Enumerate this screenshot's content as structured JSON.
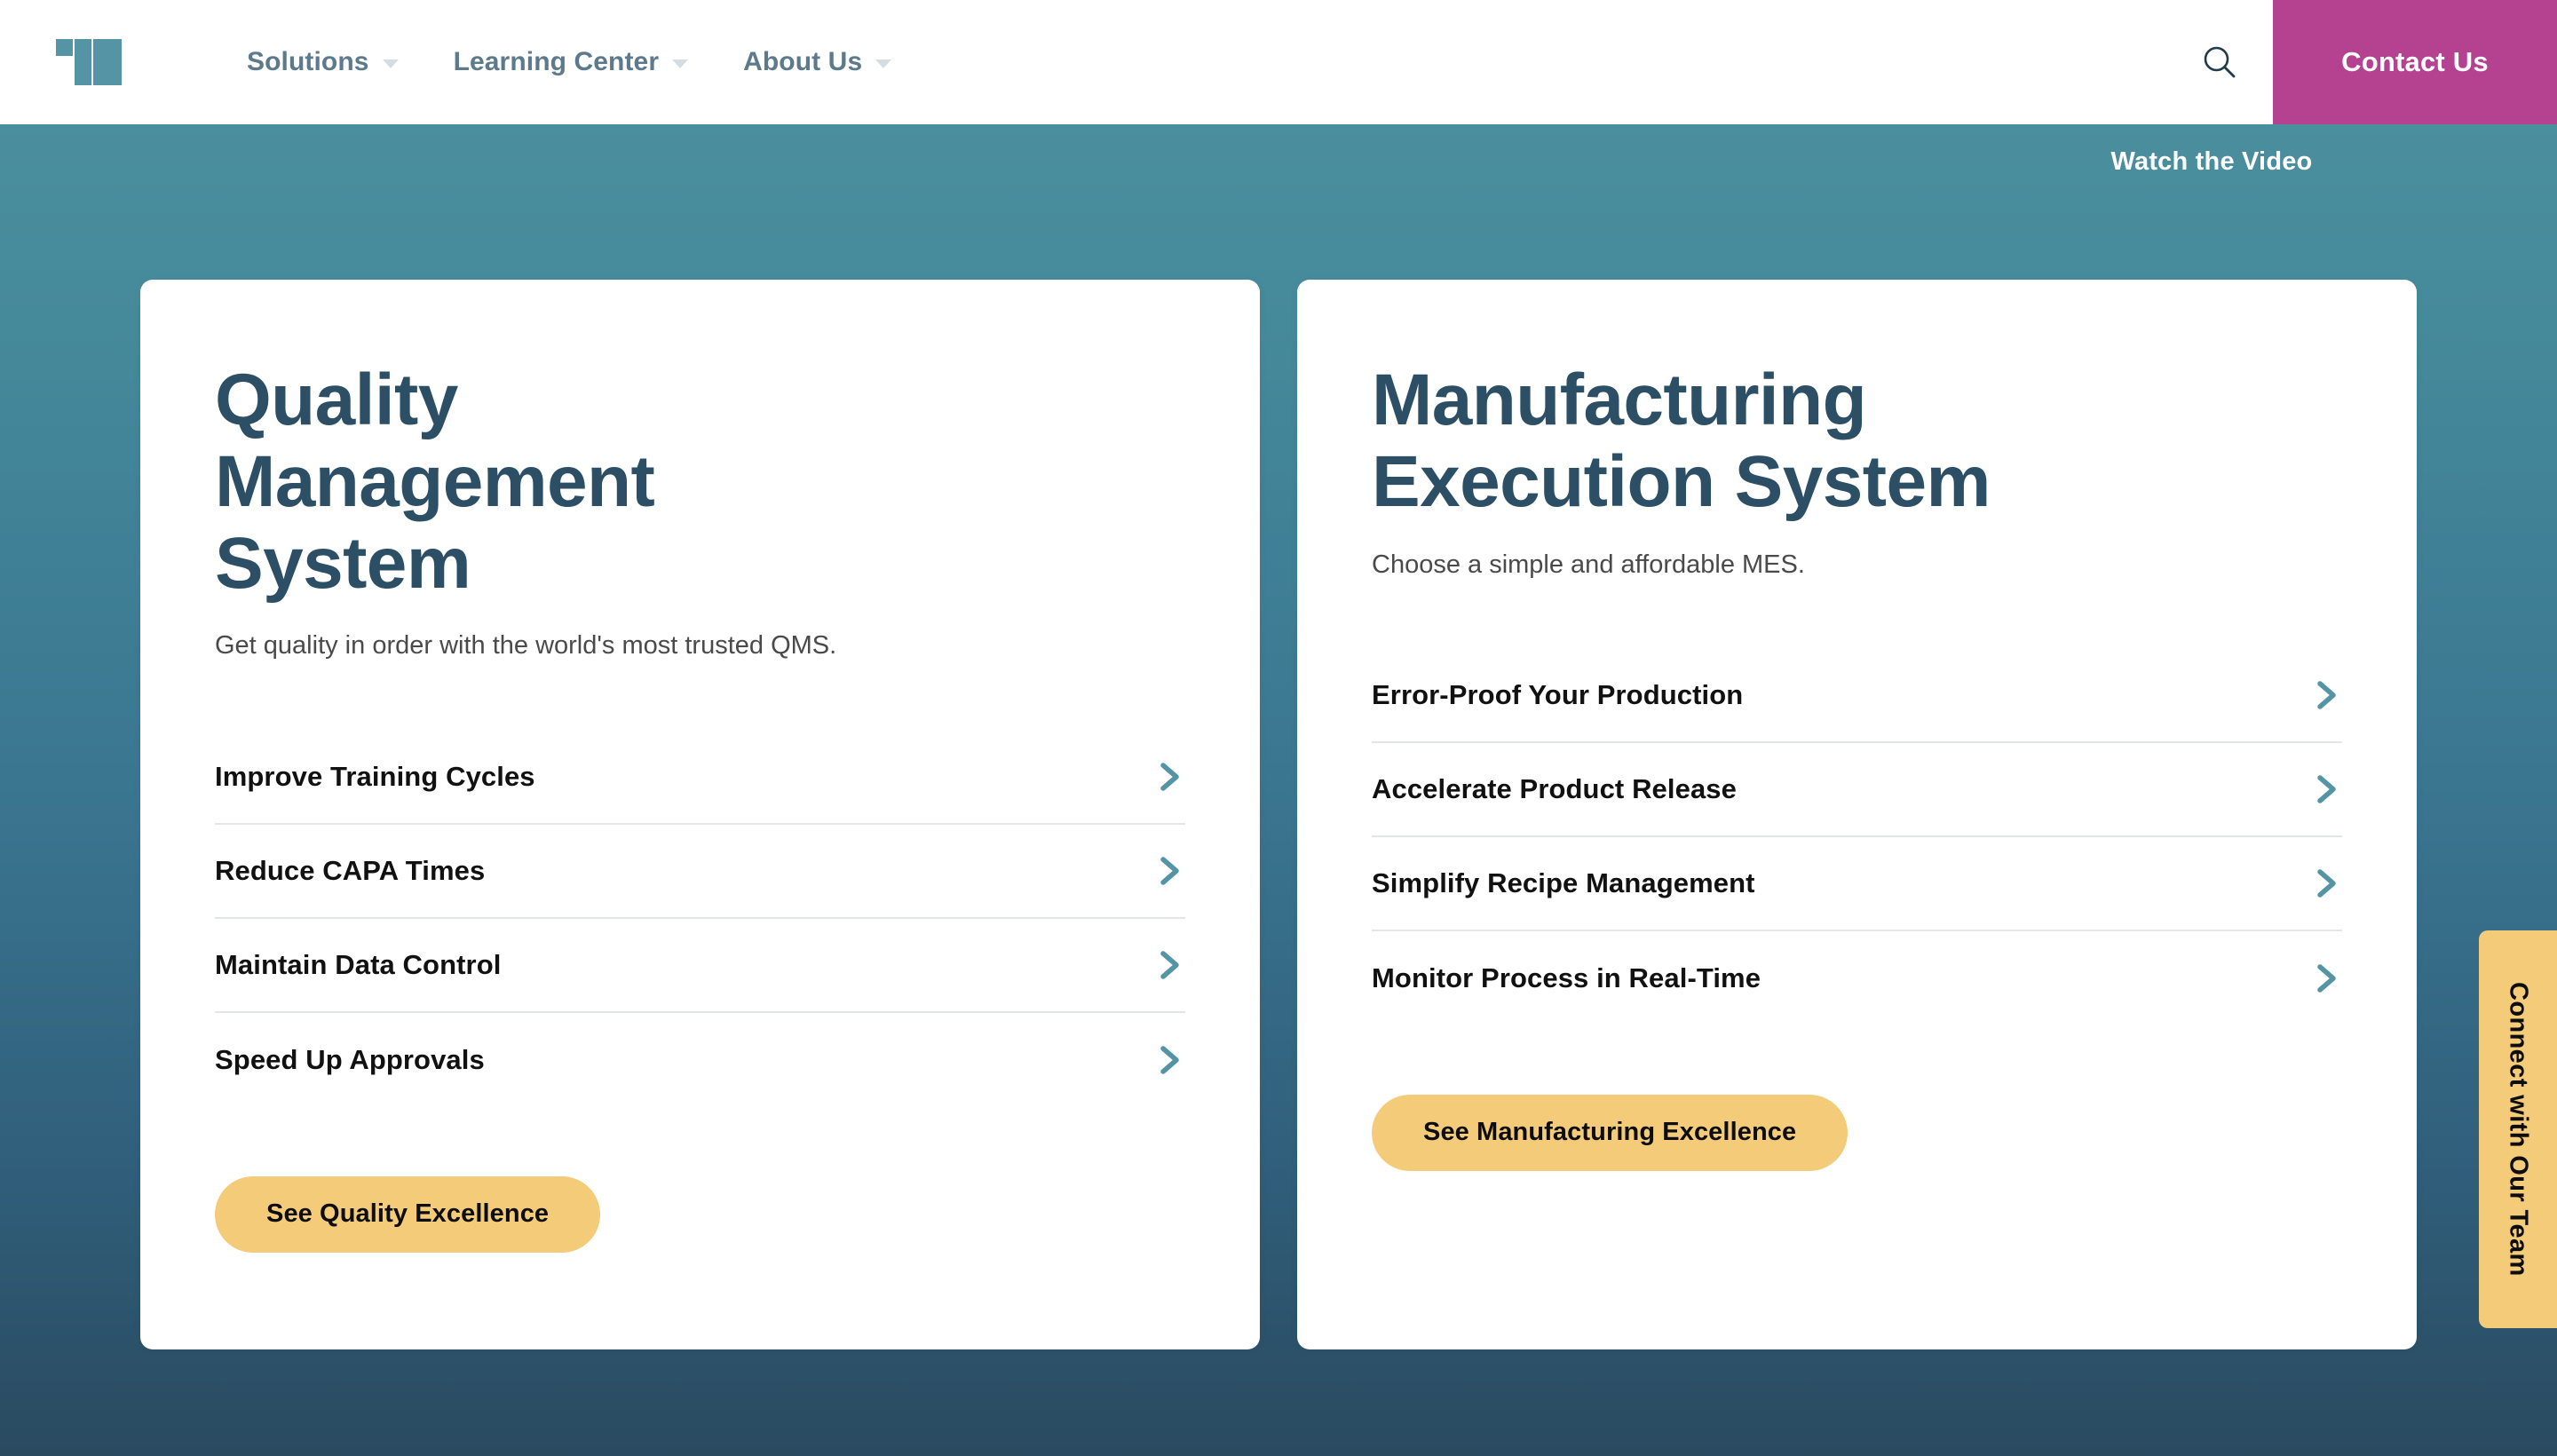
{
  "header": {
    "logo": {
      "name": "medtech-m-logo",
      "color": "#5494a4"
    },
    "nav": [
      {
        "label": "Solutions",
        "has_dropdown": true
      },
      {
        "label": "Learning Center",
        "has_dropdown": true
      },
      {
        "label": "About Us",
        "has_dropdown": true
      }
    ],
    "search_icon": "search-icon",
    "contact_button": {
      "label": "Contact Us",
      "color": "#b54191"
    }
  },
  "hero": {
    "watch_video_label": "Watch the Video",
    "background_top_color": "#4e929f",
    "background_bottom_color": "#2a4a60"
  },
  "cards": [
    {
      "title": "Quality Management System",
      "subtitle": "Get quality in order with the world's most trusted QMS.",
      "links": [
        {
          "label": "Improve Training Cycles"
        },
        {
          "label": "Reduce CAPA Times"
        },
        {
          "label": "Maintain Data Control"
        },
        {
          "label": "Speed Up Approvals"
        }
      ],
      "cta": {
        "label": "See Quality Excellence",
        "color": "#f4cc79"
      }
    },
    {
      "title": "Manufacturing Execution System",
      "subtitle": "Choose a simple and affordable MES.",
      "links": [
        {
          "label": "Error-Proof Your Production"
        },
        {
          "label": "Accelerate Product Release"
        },
        {
          "label": "Simplify Recipe Management"
        },
        {
          "label": "Monitor Process in Real-Time"
        }
      ],
      "cta": {
        "label": "See Manufacturing Excellence",
        "color": "#f4cc79"
      }
    }
  ],
  "side_tab": {
    "label": "Connect with Our Team",
    "color": "#f4cc79"
  },
  "theme": {
    "heading_color": "#2c4f66",
    "chevron_color": "#5494a4",
    "nav_text_color": "#5c7a8c",
    "divider_color": "#e2e6e9"
  }
}
